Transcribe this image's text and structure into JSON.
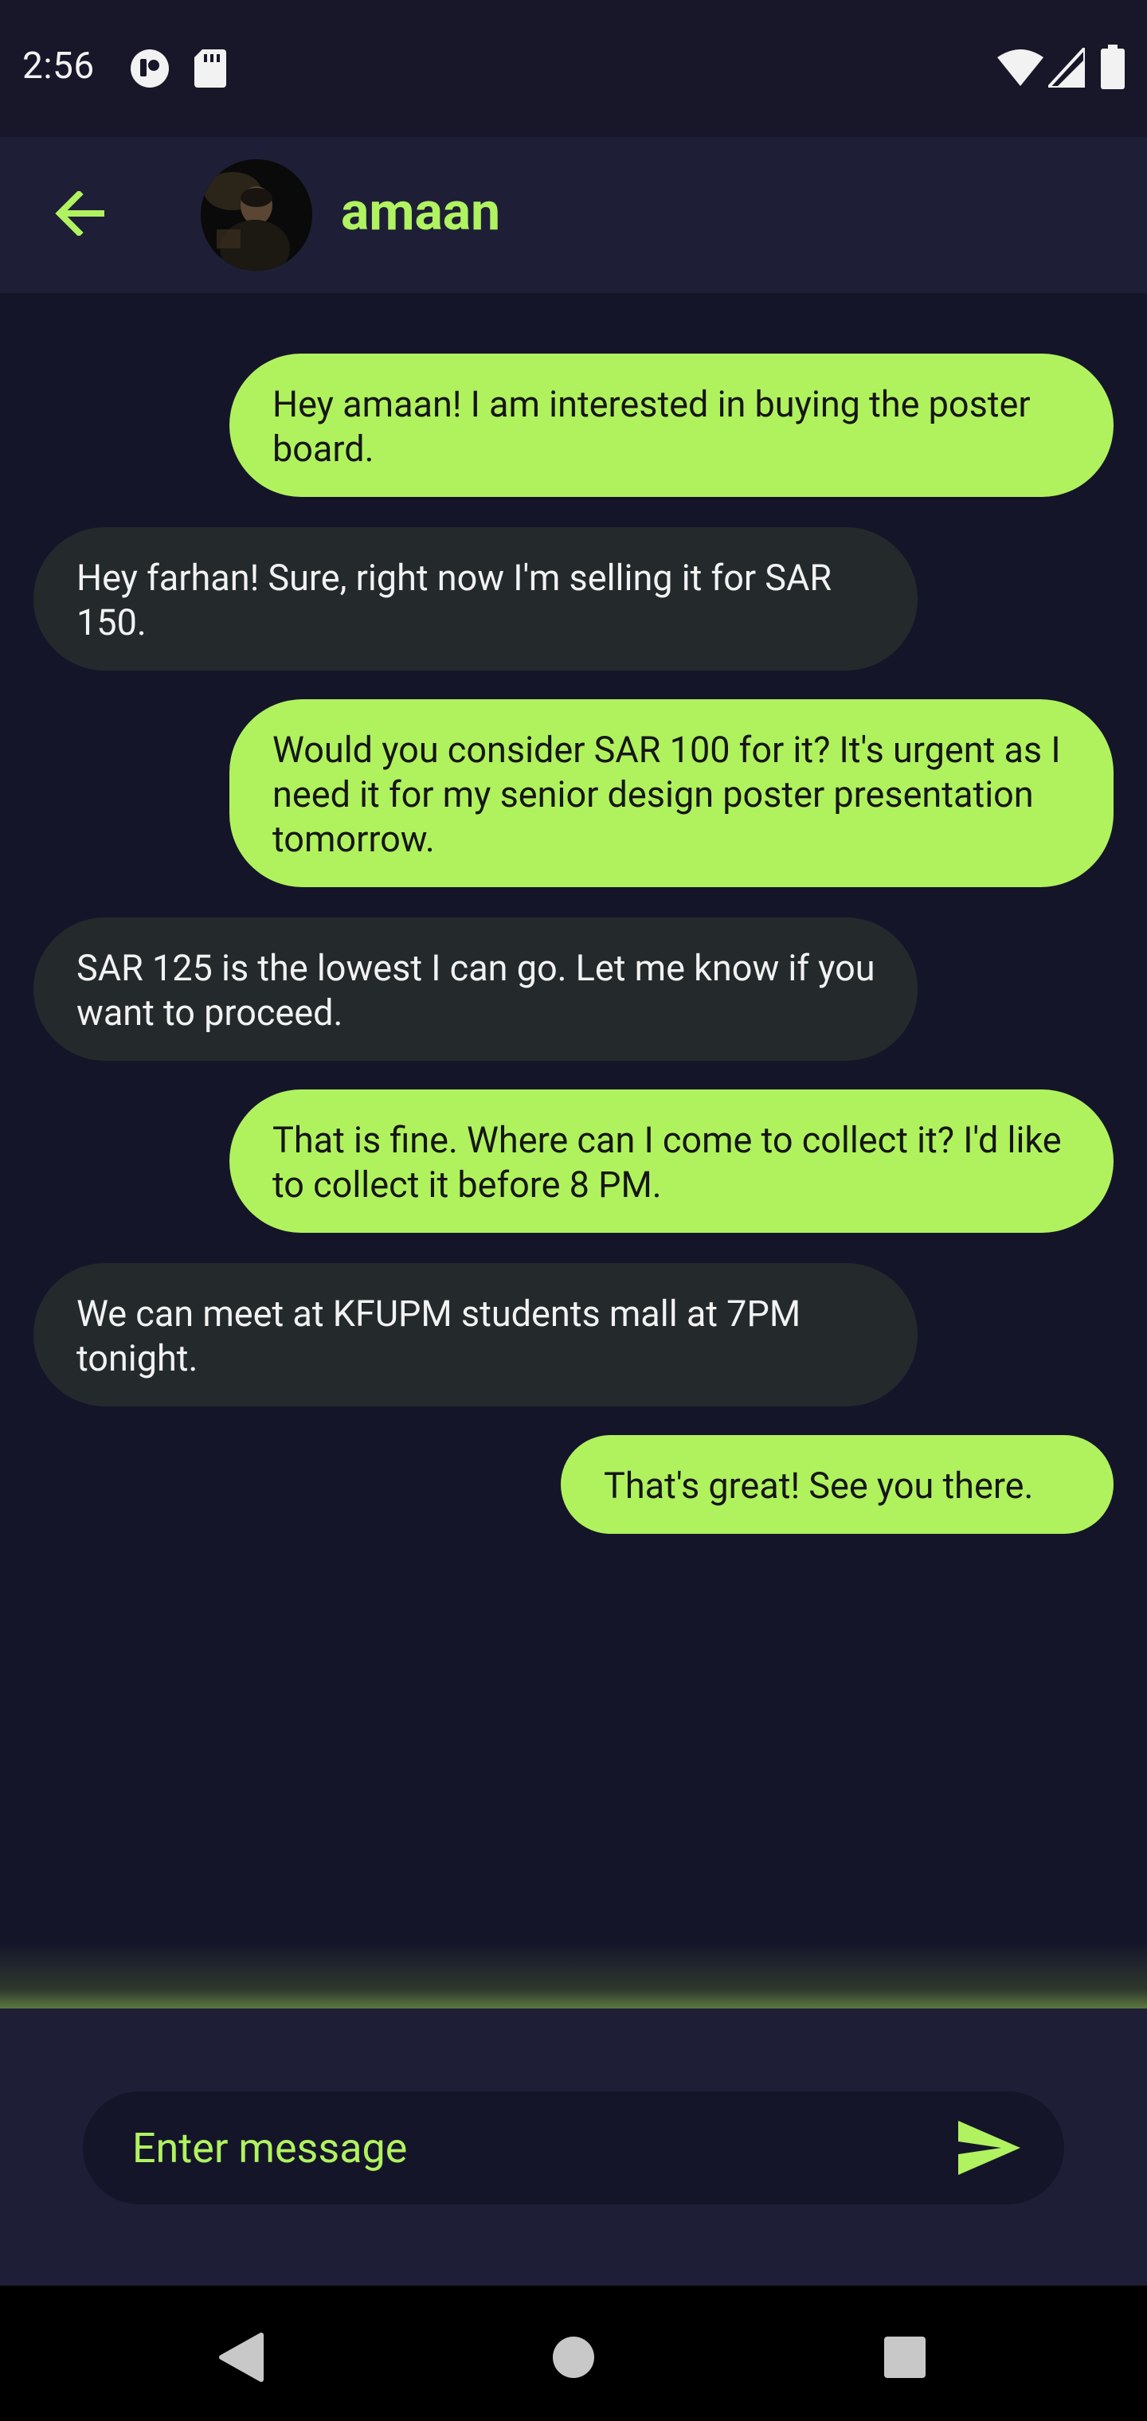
{
  "status_bar": {
    "time": "2:56",
    "left_icons": [
      "media-app-icon",
      "sd-card-icon"
    ],
    "right_icons": [
      "wifi-icon",
      "signal-icon",
      "battery-icon"
    ]
  },
  "header": {
    "contact_name": "amaan",
    "avatar_alt": "amaan"
  },
  "messages": [
    {
      "direction": "sent",
      "text": "Hey amaan! I am interested in buying the poster board."
    },
    {
      "direction": "received",
      "text": "Hey farhan! Sure, right now I'm selling it for SAR 150."
    },
    {
      "direction": "sent",
      "text": "Would you consider SAR 100 for it? It's urgent as I need it for my senior design poster presentation tomorrow."
    },
    {
      "direction": "received",
      "text": "SAR 125 is the lowest I can go. Let me know if you want to proceed."
    },
    {
      "direction": "sent",
      "text": "That is fine. Where can I come to collect it? I'd like to collect it before 8 PM."
    },
    {
      "direction": "received",
      "text": "We can meet at KFUPM students mall at 7PM tonight."
    },
    {
      "direction": "sent",
      "text": "That's great! See you there."
    }
  ],
  "composer": {
    "placeholder": "Enter message",
    "value": ""
  },
  "colors": {
    "accent": "#b0f25e",
    "background": "#15152a",
    "bar": "#1e1e36",
    "received_bubble": "#242a2b"
  }
}
